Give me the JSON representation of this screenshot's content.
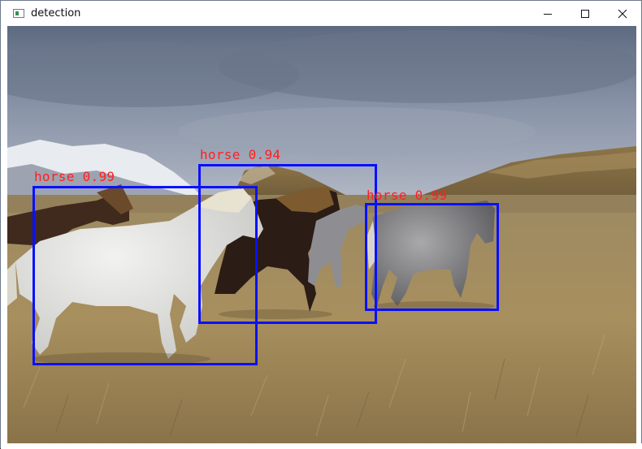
{
  "window": {
    "title": "detection",
    "app_icon": "window-app-icon",
    "controls": [
      "minimize-icon",
      "maximize-icon",
      "close-icon"
    ]
  },
  "detections": [
    {
      "label": "horse",
      "score": "0.99",
      "text": "horse 0.99",
      "color": "#0a10ff",
      "text_color": "#ff2020"
    },
    {
      "label": "horse",
      "score": "0.94",
      "text": "horse 0.94",
      "color": "#0a10ff",
      "text_color": "#ff2020"
    },
    {
      "label": "horse",
      "score": "0.99",
      "text": "horse 0.99",
      "color": "#0a10ff",
      "text_color": "#ff2020"
    }
  ]
}
